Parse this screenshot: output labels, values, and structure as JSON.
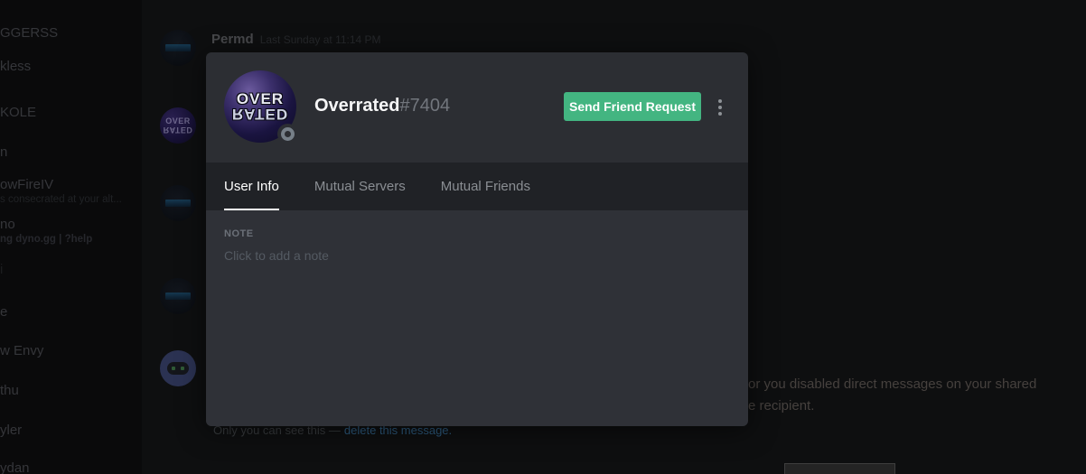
{
  "modal": {
    "username": "Overrated",
    "discriminator": "#7404",
    "avatar_text_top": "OVER",
    "avatar_text_bottom": "RATED",
    "status": "offline",
    "accent_green": "#43b581",
    "send_friend_request_label": "Send Friend Request",
    "tabs": [
      {
        "label": "User Info",
        "active": true
      },
      {
        "label": "Mutual Servers",
        "active": false
      },
      {
        "label": "Mutual Friends",
        "active": false
      }
    ],
    "note": {
      "label": "NOTE",
      "placeholder": "Click to add a note"
    }
  },
  "sidebar": {
    "items": [
      {
        "name": "GGERSS"
      },
      {
        "name": "kless"
      },
      {
        "name": "KOLE"
      },
      {
        "name": "n"
      },
      {
        "name": "owFireIV",
        "status": "s consecrated at your alt..."
      },
      {
        "name": "no",
        "status": "ng dyno.gg | ?help"
      },
      {
        "name": "i"
      },
      {
        "name": "e"
      },
      {
        "name": "w Envy"
      },
      {
        "name": "thu"
      },
      {
        "name": "yler"
      },
      {
        "name": "ydan"
      }
    ]
  },
  "chat": {
    "message_author": "Permd",
    "message_timestamp": "Last Sunday at 11:14 PM",
    "error_line1": "or you disabled direct messages on your shared",
    "error_line2": "e recipient.",
    "system_note": "Only you can see this —",
    "delete_link": "delete this message."
  }
}
